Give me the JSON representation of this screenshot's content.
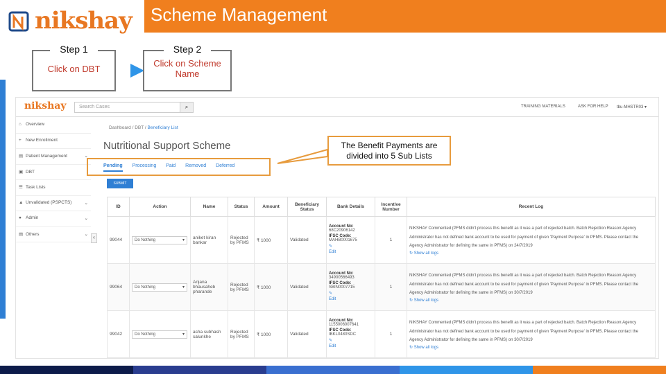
{
  "banner": {
    "title": "Scheme Management"
  },
  "logo": {
    "text": "nikshay"
  },
  "steps": [
    {
      "head": "Step 1",
      "body": "Click on DBT"
    },
    {
      "head": "Step 2",
      "body": "Click on Scheme Name"
    }
  ],
  "callout": {
    "text": "The Benefit Payments are divided into 5 Sub Lists"
  },
  "app": {
    "logo": "nikshay",
    "search_placeholder": "Search Cases",
    "nav": [
      "TRAINING MATERIALS",
      "ASK FOR HELP",
      "tbu-MHSTR03 ▾"
    ],
    "sidebar": [
      {
        "icon": "⌂",
        "label": "Overview"
      },
      {
        "icon": "+",
        "label": "New Enrollment"
      },
      {
        "icon": "▤",
        "label": "Patient Management",
        "chev": "⌄"
      },
      {
        "icon": "▣",
        "label": "DBT"
      },
      {
        "icon": "☰",
        "label": "Task Lists"
      },
      {
        "icon": "▲",
        "label": "Unvalidated (PSPCTS)",
        "chev": "⌄"
      },
      {
        "icon": "●",
        "label": "Admin",
        "chev": "⌄"
      },
      {
        "icon": "▤",
        "label": "Others",
        "chev": "⌄"
      }
    ],
    "breadcrumb": {
      "home": "Dashboard",
      "dbt": "DBT",
      "current": "Beneficiary List"
    },
    "page_title": "Nutritional Support Scheme",
    "tabs": [
      "Pending",
      "Processing",
      "Paid",
      "Removed",
      "Deferred"
    ],
    "submit_label": "SUBMIT",
    "columns": [
      "ID",
      "Action",
      "Name",
      "Status",
      "Amount",
      "Beneficiary Status",
      "Bank Details",
      "Incentive Number",
      "Recent Log"
    ],
    "rows": [
      {
        "id": "99044",
        "action": "Do Nothing",
        "name": "aniket kiran bankar",
        "status": "Rejected by PFMS",
        "amount": "₹ 1000",
        "ben": "Validated",
        "acc_label": "Account No:",
        "acc": "68C20906142",
        "ifsc_label": "IFSC Code:",
        "ifsc": "MAHB0001675",
        "edit": "Edit",
        "inc": "1",
        "log": "NIKSHAY Commented (PFMS didn't process this benefit as it was a part of rejected batch. Batch Rejection Reason:Agency Administrator has not defined bank account to be used for payment of given 'Payment Purpose' in PFMS. Please contact the Agency Administrator for defining the same in PFMS) on 24/7/2019",
        "showlog": "Show all logs"
      },
      {
        "id": "99064",
        "action": "Do Nothing",
        "name": "Anjana bhausaheb pharande",
        "status": "Rejected by PFMS",
        "amount": "₹ 1000",
        "ben": "Validated",
        "acc_label": "Account No:",
        "acc": "34900566493",
        "ifsc_label": "IFSC Code:",
        "ifsc": "SBIN0007715",
        "edit": "Edit",
        "inc": "1",
        "log": "NIKSHAY Commented (PFMS didn't process this benefit as it was a part of rejected batch. Batch Rejection Reason:Agency Administrator has not defined bank account to be used for payment of given 'Payment Purpose' in PFMS. Please contact the Agency Administrator for defining the same in PFMS) on 30/7/2019",
        "showlog": "Show all logs"
      },
      {
        "id": "99042",
        "action": "Do Nothing",
        "name": "asha subhash salunkhe",
        "status": "Rejected by PFMS",
        "amount": "₹ 1000",
        "ben": "Validated",
        "acc_label": "Account No:",
        "acc": "1155006007641",
        "ifsc_label": "IFSC Code:",
        "ifsc": "IBKL0480SDC",
        "edit": "Edit",
        "inc": "1",
        "log": "NIKSHAY Commented (PFMS didn't process this benefit as it was a part of rejected batch. Batch Rejection Reason:Agency Administrator has not defined bank account to be used for payment of given 'Payment Purpose' in PFMS. Please contact the Agency Administrator for defining the same in PFMS) on 30/7/2019",
        "showlog": "Show all logs"
      }
    ]
  },
  "footer_colors": [
    "#0d1b4a",
    "#2a3d8f",
    "#3a6fd0",
    "#2f95e8",
    "#f07f1e"
  ]
}
